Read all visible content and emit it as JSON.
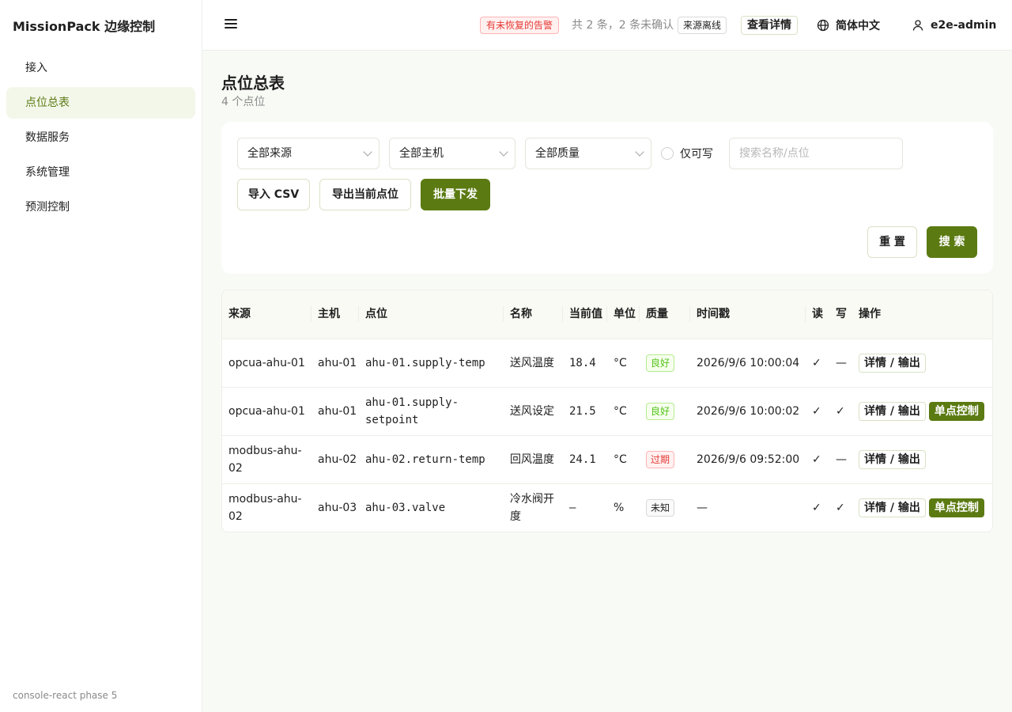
{
  "app": {
    "title": "MissionPack 边缘控制",
    "footer": "console-react phase 5"
  },
  "sidebar": {
    "items": [
      {
        "label": "接入",
        "active": false
      },
      {
        "label": "点位总表",
        "active": true
      },
      {
        "label": "数据服务",
        "active": false
      },
      {
        "label": "系统管理",
        "active": false
      },
      {
        "label": "预测控制",
        "active": false
      }
    ]
  },
  "header": {
    "alarm_badge": "有未恢复的告警",
    "alarm_count": "共 2 条，2 条未确认",
    "source_tag": "来源离线",
    "detail_button": "查看详情",
    "language": "简体中文",
    "user": "e2e-admin"
  },
  "page": {
    "title": "点位总表",
    "subtitle": "4 个点位"
  },
  "filters": {
    "source_select": "全部来源",
    "host_select": "全部主机",
    "quality_select": "全部质量",
    "writable_only": "仅可写",
    "search_placeholder": "搜索名称/点位",
    "import_button": "导入 CSV",
    "export_button": "导出当前点位",
    "batch_button": "批量下发",
    "reset_button": "重 置",
    "search_button": "搜 索"
  },
  "table": {
    "headers": {
      "source": "来源",
      "host": "主机",
      "point": "点位",
      "name": "名称",
      "current_value": "当前值",
      "unit": "单位",
      "quality": "质量",
      "timestamp": "时间戳",
      "read": "读",
      "write": "写",
      "ops": "操作"
    },
    "rows": [
      {
        "source": "opcua-ahu-01",
        "host": "ahu-01",
        "point": "ahu-01.supply-temp",
        "name": "送风温度",
        "value": "18.4",
        "unit": "°C",
        "quality": "良好",
        "quality_level": "good",
        "timestamp": "2026/9/6 10:00:04",
        "read": "✓",
        "write": "—",
        "detail": "详情 / 输出",
        "control": ""
      },
      {
        "source": "opcua-ahu-01",
        "host": "ahu-01",
        "point": "ahu-01.supply-setpoint",
        "name": "送风设定",
        "value": "21.5",
        "unit": "°C",
        "quality": "良好",
        "quality_level": "good",
        "timestamp": "2026/9/6 10:00:02",
        "read": "✓",
        "write": "✓",
        "detail": "详情 / 输出",
        "control": "单点控制"
      },
      {
        "source": "modbus-ahu-02",
        "host": "ahu-02",
        "point": "ahu-02.return-temp",
        "name": "回风温度",
        "value": "24.1",
        "unit": "°C",
        "quality": "过期",
        "quality_level": "stale",
        "timestamp": "2026/9/6 09:52:00",
        "read": "✓",
        "write": "—",
        "detail": "详情 / 输出",
        "control": ""
      },
      {
        "source": "modbus-ahu-02",
        "host": "ahu-03",
        "point": "ahu-03.valve",
        "name": "冷水阀开度",
        "value": "—",
        "unit": "%",
        "quality": "未知",
        "quality_level": "unknown",
        "timestamp": "—",
        "read": "✓",
        "write": "✓",
        "detail": "详情 / 输出",
        "control": "单点控制"
      }
    ]
  },
  "colors": {
    "accent": "#5b7a12",
    "accent_light": "#f3f7ea",
    "alarm": "#e53935",
    "good": "#52c41a"
  }
}
